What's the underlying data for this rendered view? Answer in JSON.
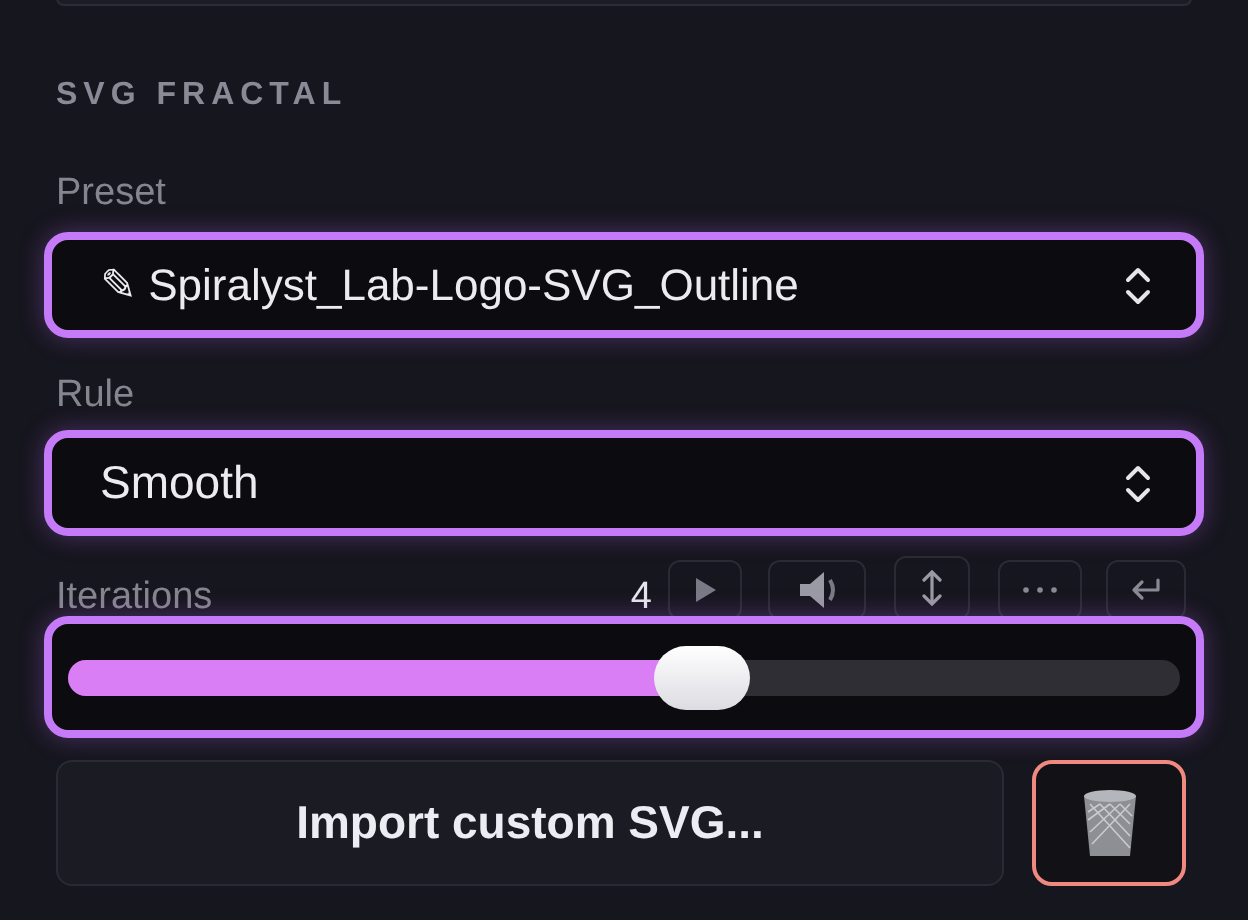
{
  "section": {
    "title": "SVG FRACTAL"
  },
  "preset": {
    "label": "Preset",
    "value": "✎ Spiralyst_Lab-Logo-SVG_Outline",
    "focused": true
  },
  "rule": {
    "label": "Rule",
    "value": "Smooth",
    "focused": true
  },
  "iterations": {
    "label": "Iterations",
    "reading": "4",
    "level": 0.57,
    "focused": true
  },
  "buttons": {
    "import": "Import custom SVG..."
  }
}
